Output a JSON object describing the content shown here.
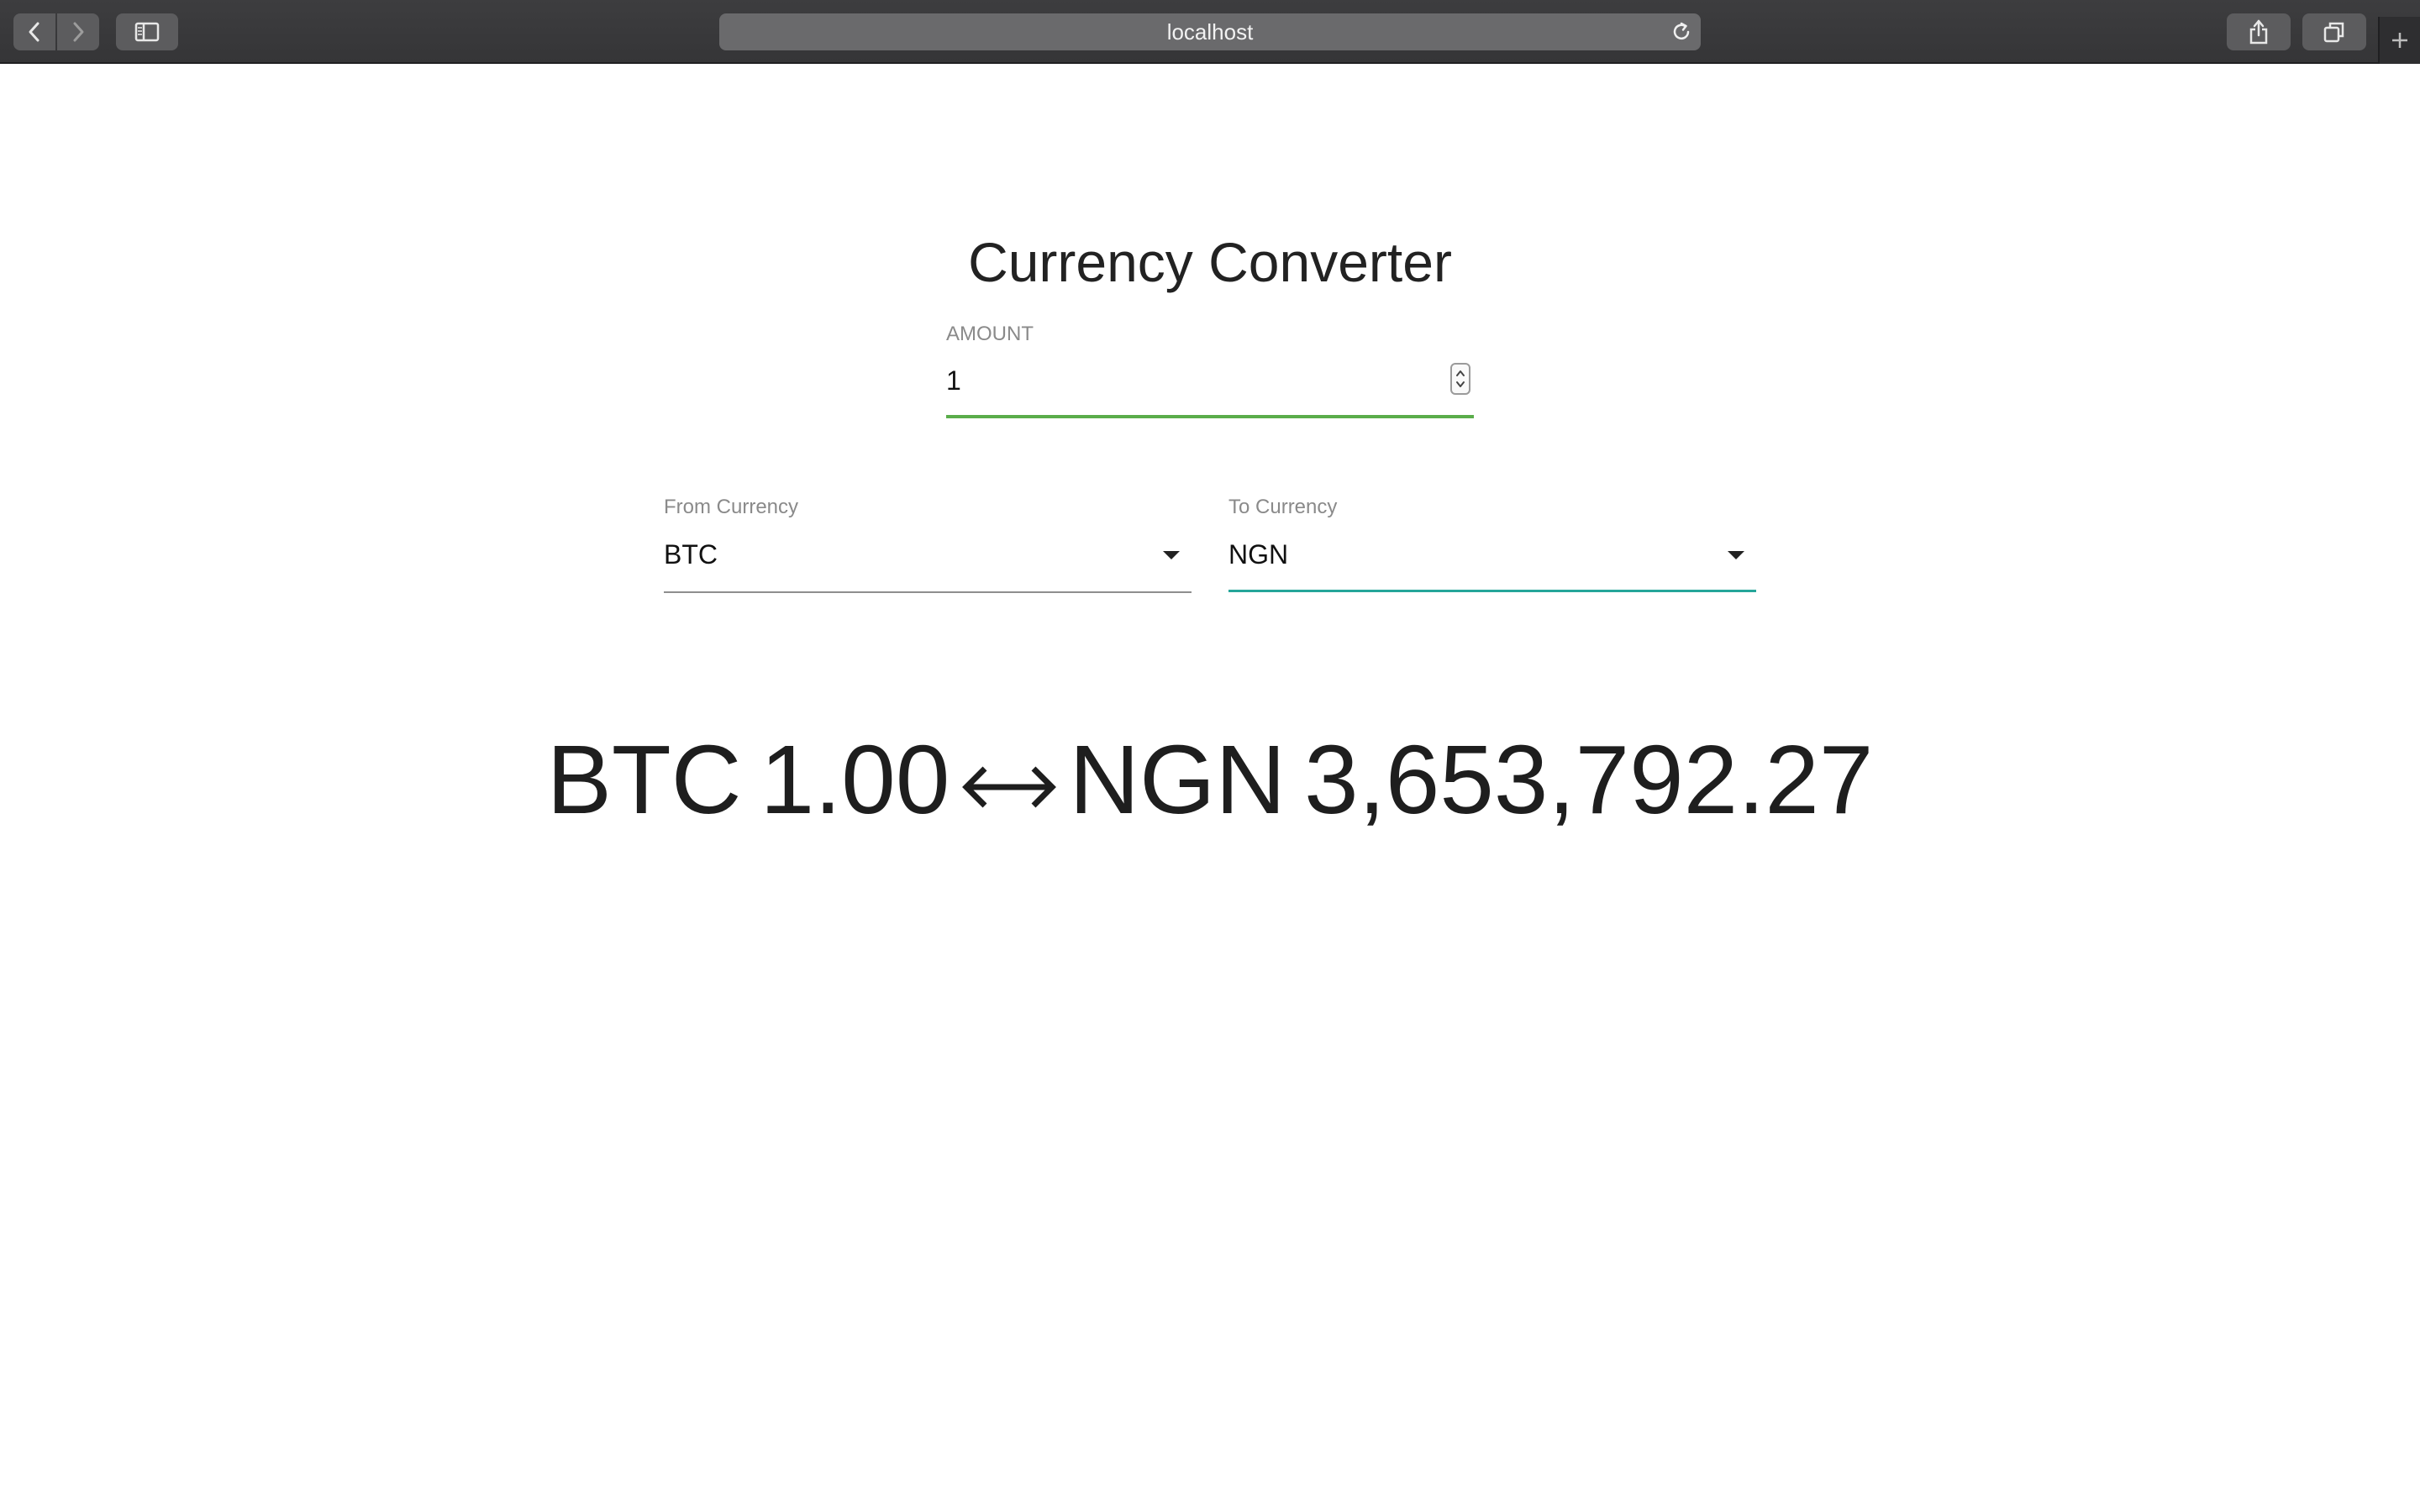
{
  "browser": {
    "url": "localhost",
    "icons": {
      "back": "chevron-left-icon",
      "forward": "chevron-right-icon",
      "sidebar": "sidebar-icon",
      "reload": "reload-icon",
      "share": "share-icon",
      "tabs": "tabs-overview-icon",
      "new_tab": "plus-icon"
    }
  },
  "app": {
    "title": "Currency Converter",
    "amount": {
      "label": "AMOUNT",
      "value": "1"
    },
    "from_currency": {
      "label": "From Currency",
      "value": "BTC"
    },
    "to_currency": {
      "label": "To Currency",
      "value": "NGN"
    },
    "result": {
      "from_code": "BTC",
      "from_amount": "1.00",
      "to_code": "NGN",
      "to_amount": "3,653,792.27"
    }
  },
  "colors": {
    "amount_underline": "#5aad4a",
    "to_currency_underline": "#26a69a",
    "from_currency_underline": "#8e8e8e"
  }
}
